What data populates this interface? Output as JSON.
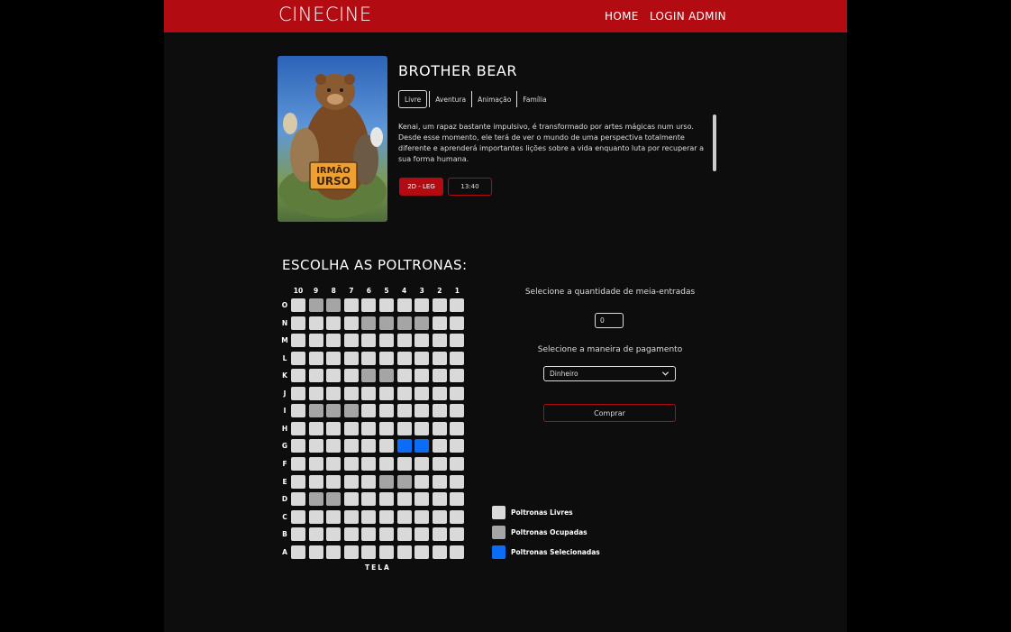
{
  "header": {
    "brand": "CINECINE",
    "nav": [
      "HOME",
      "LOGIN ADMIN"
    ]
  },
  "movie": {
    "title": "BROTHER BEAR",
    "poster_text": [
      "IRMÃO",
      "URSO"
    ],
    "rating": "Livre",
    "genres": [
      "Aventura",
      "Animação",
      "Família"
    ],
    "synopsis": "Kenai, um rapaz bastante impulsivo, é transformado por artes mágicas num urso. Desde esse momento, ele terá de ver o mundo de uma perspectiva totalmente diferente e aprenderá importantes lições sobre a vida enquanto luta por recuperar a sua forma humana.",
    "sessions": [
      "2D - LEG",
      "13:40"
    ]
  },
  "seats": {
    "title": "ESCOLHA AS POLTRONAS:",
    "columns": [
      "10",
      "9",
      "8",
      "7",
      "6",
      "5",
      "4",
      "3",
      "2",
      "1"
    ],
    "rows": [
      {
        "label": "O",
        "states": [
          "free",
          "occupied",
          "occupied",
          "free",
          "free",
          "free",
          "free",
          "free",
          "free",
          "free"
        ]
      },
      {
        "label": "N",
        "states": [
          "free",
          "free",
          "free",
          "free",
          "occupied",
          "occupied",
          "occupied",
          "occupied",
          "free",
          "free"
        ]
      },
      {
        "label": "M",
        "states": [
          "free",
          "free",
          "free",
          "free",
          "free",
          "free",
          "free",
          "free",
          "free",
          "free"
        ]
      },
      {
        "label": "L",
        "states": [
          "free",
          "free",
          "free",
          "free",
          "free",
          "free",
          "free",
          "free",
          "free",
          "free"
        ]
      },
      {
        "label": "K",
        "states": [
          "free",
          "free",
          "free",
          "free",
          "occupied",
          "occupied",
          "free",
          "free",
          "free",
          "free"
        ]
      },
      {
        "label": "J",
        "states": [
          "free",
          "free",
          "free",
          "free",
          "free",
          "free",
          "free",
          "free",
          "free",
          "free"
        ]
      },
      {
        "label": "I",
        "states": [
          "free",
          "occupied",
          "occupied",
          "occupied",
          "free",
          "free",
          "free",
          "free",
          "free",
          "free"
        ]
      },
      {
        "label": "H",
        "states": [
          "free",
          "free",
          "free",
          "free",
          "free",
          "free",
          "free",
          "free",
          "free",
          "free"
        ]
      },
      {
        "label": "G",
        "states": [
          "free",
          "free",
          "free",
          "free",
          "free",
          "free",
          "selected",
          "selected",
          "free",
          "free"
        ]
      },
      {
        "label": "F",
        "states": [
          "free",
          "free",
          "free",
          "free",
          "free",
          "free",
          "free",
          "free",
          "free",
          "free"
        ]
      },
      {
        "label": "E",
        "states": [
          "free",
          "free",
          "free",
          "free",
          "free",
          "occupied",
          "occupied",
          "free",
          "free",
          "free"
        ]
      },
      {
        "label": "D",
        "states": [
          "free",
          "occupied",
          "occupied",
          "free",
          "free",
          "free",
          "free",
          "free",
          "free",
          "free"
        ]
      },
      {
        "label": "C",
        "states": [
          "free",
          "free",
          "free",
          "free",
          "free",
          "free",
          "free",
          "free",
          "free",
          "free"
        ]
      },
      {
        "label": "B",
        "states": [
          "free",
          "free",
          "free",
          "free",
          "free",
          "free",
          "free",
          "free",
          "free",
          "free"
        ]
      },
      {
        "label": "A",
        "states": [
          "free",
          "free",
          "free",
          "free",
          "free",
          "free",
          "free",
          "free",
          "free",
          "free"
        ]
      }
    ],
    "screen_label": "TELA"
  },
  "form": {
    "half_price_label": "Selecione a quantidade de meia-entradas",
    "half_price_value": "0",
    "payment_label": "Selecione a maneira de pagamento",
    "payment_value": "Dinheiro",
    "buy_label": "Comprar"
  },
  "legend": {
    "free": "Poltronas Livres",
    "occupied": "Poltronas Ocupadas",
    "selected": "Poltronas Selecionadas"
  },
  "colors": {
    "brand_red": "#b30b12",
    "seat_free": "#d9d9d9",
    "seat_occupied": "#a5a5a5",
    "seat_selected": "#0b6cf5"
  }
}
